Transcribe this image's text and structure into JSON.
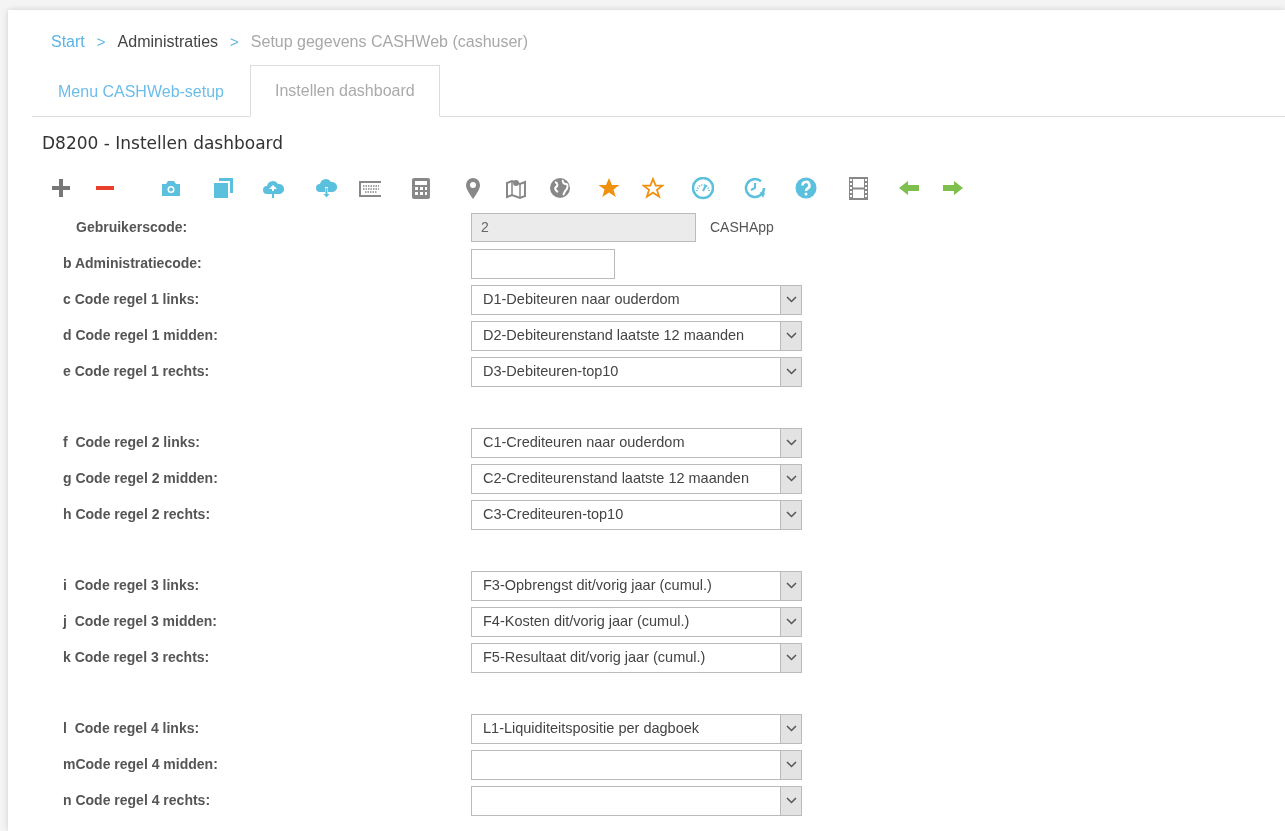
{
  "breadcrumb": [
    {
      "text": "Start",
      "kind": "link"
    },
    {
      "text": ">",
      "kind": "separator"
    },
    {
      "text": "Administraties",
      "kind": "page"
    },
    {
      "text": ">",
      "kind": "separator"
    },
    {
      "text": "Setup gegevens CASHWeb (cashuser)",
      "kind": "current"
    }
  ],
  "tabs": [
    {
      "label": "Menu CASHWeb-setup",
      "selected": false
    },
    {
      "label": "Instellen dashboard",
      "selected": true
    }
  ],
  "title": "D8200 - Instellen dashboard",
  "form": {
    "groups": [
      {
        "fields": [
          {
            "label": "Gebruikerscode:",
            "kind": "readonly",
            "value": "2",
            "suffix": "CASHApp"
          },
          {
            "label": "b Administratiecode:",
            "kind": "text"
          },
          {
            "label": "c Code regel 1 links:",
            "kind": "select",
            "value": "D1-Debiteuren naar ouderdom"
          },
          {
            "label": "d Code regel 1 midden:",
            "kind": "select",
            "value": "D2-Debiteurenstand laatste 12 maanden"
          },
          {
            "label": "e Code regel 1 rechts:",
            "kind": "select",
            "value": "D3-Debiteuren-top10"
          }
        ]
      },
      {
        "fields": [
          {
            "label": "f  Code regel 2 links:",
            "kind": "select",
            "value": "C1-Crediteuren naar ouderdom"
          },
          {
            "label": "g Code regel 2 midden:",
            "kind": "select",
            "value": "C2-Crediteurenstand laatste 12 maanden"
          },
          {
            "label": "h Code regel 2 rechts:",
            "kind": "select",
            "value": "C3-Crediteuren-top10"
          }
        ]
      },
      {
        "fields": [
          {
            "label": "i  Code regel 3 links:",
            "kind": "select",
            "value": "F3-Opbrengst dit/vorig jaar (cumul.)"
          },
          {
            "label": "j  Code regel 3 midden:",
            "kind": "select",
            "value": "F4-Kosten dit/vorig jaar (cumul.)"
          },
          {
            "label": "k Code regel 3 rechts:",
            "kind": "select",
            "value": "F5-Resultaat dit/vorig jaar (cumul.)"
          }
        ]
      },
      {
        "fields": [
          {
            "label": "l  Code regel 4 links:",
            "kind": "select",
            "value": "L1-Liquiditeitspositie per dagboek"
          },
          {
            "label": "mCode regel 4 midden:",
            "kind": "select"
          },
          {
            "label": "n Code regel 4 rechts:",
            "kind": "select"
          }
        ]
      }
    ]
  }
}
